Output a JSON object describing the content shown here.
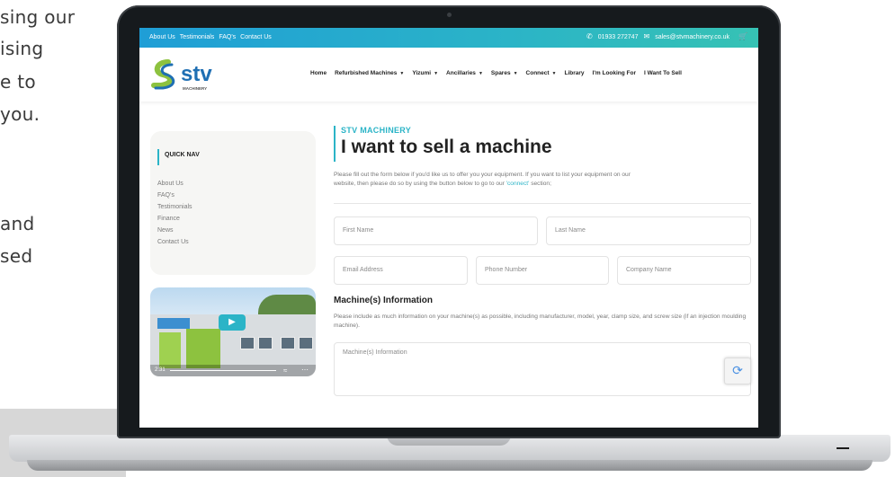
{
  "side_text": [
    "sing our",
    "ising",
    "e to",
    "you.",
    "and",
    "sed"
  ],
  "topbar": {
    "links": [
      "About Us",
      "Testimonials",
      "FAQ's",
      "Contact Us"
    ],
    "phone": "01933 272747",
    "email": "sales@stvmachinery.co.uk",
    "icons": [
      "phone-icon",
      "mail-icon",
      "cart-icon"
    ]
  },
  "logo": {
    "text": "stv",
    "sub": "MACHINERY"
  },
  "nav": {
    "items": [
      {
        "label": "Home",
        "dropdown": false
      },
      {
        "label": "Refurbished Machines",
        "dropdown": true
      },
      {
        "label": "Yizumi",
        "dropdown": true
      },
      {
        "label": "Ancillaries",
        "dropdown": true
      },
      {
        "label": "Spares",
        "dropdown": true
      },
      {
        "label": "Connect",
        "dropdown": true
      },
      {
        "label": "Library",
        "dropdown": false
      },
      {
        "label": "I'm Looking For",
        "dropdown": false
      },
      {
        "label": "I Want To Sell",
        "dropdown": false
      }
    ]
  },
  "quick_nav": {
    "title": "QUICK NAV",
    "links": [
      "About Us",
      "FAQ's",
      "Testimonials",
      "Finance",
      "News",
      "Contact Us"
    ]
  },
  "video": {
    "time": "2:31"
  },
  "main": {
    "kicker": "STV MACHINERY",
    "title": "I want to sell a machine",
    "intro_a": "Please fill out the form below if you'd like us to offer you your equipment. If you want to list your equipment on our",
    "intro_b": "website, then please do so by using the button below to go to our",
    "intro_link": "'connect'",
    "intro_c": "section;",
    "form": {
      "first_name": "First Name",
      "last_name": "Last Name",
      "email": "Email Address",
      "phone": "Phone Number",
      "company": "Company Name"
    },
    "machine_heading": "Machine(s) Information",
    "machine_desc": "Please include as much information on your machine(s) as possible, including manufacturer, model, year, clamp size, and screw size (if an injection moulding machine).",
    "machine_placeholder": "Machine(s) Information"
  },
  "colors": {
    "accent": "#2bb4c7",
    "topbar_start": "#1f9ed6",
    "logo_green": "#8dc23f",
    "logo_blue": "#1f6fb3"
  }
}
